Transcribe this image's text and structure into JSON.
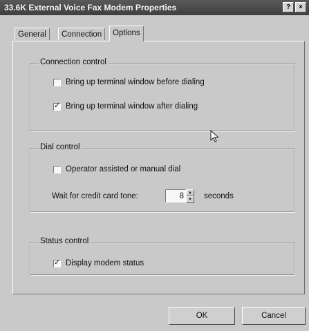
{
  "window": {
    "title": "33.6K External Voice Fax Modem Properties",
    "help_button": "?",
    "close_button": "×"
  },
  "tabs": [
    {
      "label": "General"
    },
    {
      "label": "Connection"
    },
    {
      "label": "Options",
      "active": true
    }
  ],
  "connection_control": {
    "title": "Connection control",
    "terminal_before": {
      "label": "Bring up terminal window before dialing",
      "checked": false
    },
    "terminal_after": {
      "label": "Bring up terminal window after dialing",
      "checked": true
    }
  },
  "dial_control": {
    "title": "Dial control",
    "operator_assisted": {
      "label": "Operator assisted or manual dial",
      "checked": false
    },
    "wait_label": "Wait for credit card tone:",
    "wait_value": "8",
    "wait_unit": "seconds"
  },
  "status_control": {
    "title": "Status control",
    "display_status": {
      "label": "Display modem status",
      "checked": true
    }
  },
  "buttons": {
    "ok": "OK",
    "cancel": "Cancel"
  },
  "marks": {
    "check": "✓"
  }
}
